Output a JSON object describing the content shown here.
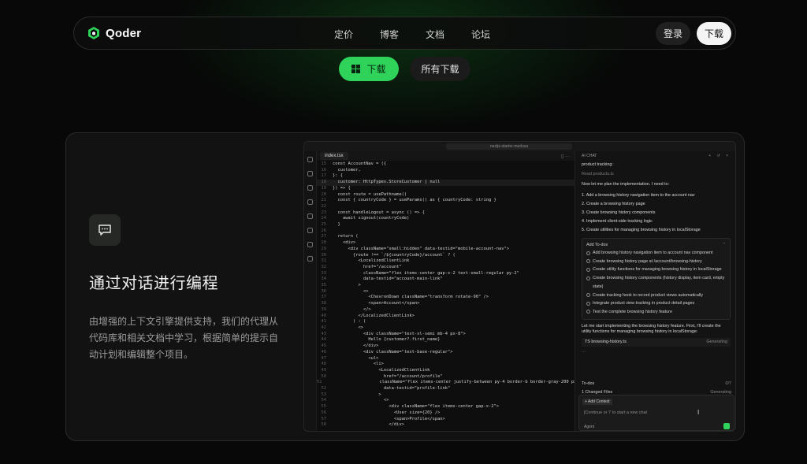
{
  "nav": {
    "brand": "Qoder",
    "links": [
      "定价",
      "博客",
      "文档",
      "论坛"
    ],
    "login": "登录",
    "download": "下载"
  },
  "hero": {
    "download": "下载",
    "all_downloads": "所有下载"
  },
  "feature": {
    "title": "通过对话进行编程",
    "description": "由增强的上下文引擎提供支持，我们的代理从代码库和相关文档中学习，根据简单的提示自动计划和编辑整个项目。"
  },
  "ide": {
    "window_title": "nextjs-starter-medusa",
    "tab": "index.tsx",
    "code_lines": [
      {
        "n": "15",
        "t": "const AccountNav = ({"
      },
      {
        "n": "16",
        "t": "  customer,"
      },
      {
        "n": "17",
        "t": "}: {"
      },
      {
        "n": "18",
        "t": "  customer: HttpTypes.StoreCustomer | null"
      },
      {
        "n": "19",
        "t": "}) => {"
      },
      {
        "n": "20",
        "t": "  const route = usePathname()"
      },
      {
        "n": "21",
        "t": "  const { countryCode } = useParams() as { countryCode: string }"
      },
      {
        "n": "22",
        "t": ""
      },
      {
        "n": "23",
        "t": "  const handleLogout = async () => {"
      },
      {
        "n": "24",
        "t": "    await signout(countryCode)"
      },
      {
        "n": "25",
        "t": "  }"
      },
      {
        "n": "26",
        "t": ""
      },
      {
        "n": "27",
        "t": "  return ("
      },
      {
        "n": "28",
        "t": "    <div>"
      },
      {
        "n": "29",
        "t": "      <div className=\"small:hidden\" data-testid=\"mobile-account-nav\">"
      },
      {
        "n": "30",
        "t": "        {route !== `/${countryCode}/account` ? ("
      },
      {
        "n": "31",
        "t": "          <LocalizedClientLink"
      },
      {
        "n": "32",
        "t": "            href=\"/account\""
      },
      {
        "n": "33",
        "t": "            className=\"flex items-center gap-x-2 text-small-regular py-2\""
      },
      {
        "n": "34",
        "t": "            data-testid=\"account-main-link\""
      },
      {
        "n": "35",
        "t": "          >"
      },
      {
        "n": "36",
        "t": "            <>"
      },
      {
        "n": "37",
        "t": "              <ChevronDown className=\"transform rotate-90\" />"
      },
      {
        "n": "38",
        "t": "              <span>Account</span>"
      },
      {
        "n": "39",
        "t": "            </>"
      },
      {
        "n": "40",
        "t": "          </LocalizedClientLink>"
      },
      {
        "n": "41",
        "t": "        ) : ("
      },
      {
        "n": "42",
        "t": "          <>"
      },
      {
        "n": "43",
        "t": "            <div className=\"text-xl-semi mb-4 px-8\">"
      },
      {
        "n": "44",
        "t": "              Hello {customer?.first_name}"
      },
      {
        "n": "45",
        "t": "            </div>"
      },
      {
        "n": "46",
        "t": "            <div className=\"text-base-regular\">"
      },
      {
        "n": "47",
        "t": "              <ul>"
      },
      {
        "n": "48",
        "t": "                <li>"
      },
      {
        "n": "49",
        "t": "                  <LocalizedClientLink"
      },
      {
        "n": "50",
        "t": "                    href=\"/account/profile\""
      },
      {
        "n": "51",
        "t": "                    className=\"flex items-center justify-between py-4 border-b border-gray-200 px-8\""
      },
      {
        "n": "52",
        "t": "                    data-testid=\"profile-link\""
      },
      {
        "n": "53",
        "t": "                  >"
      },
      {
        "n": "54",
        "t": "                    <>"
      },
      {
        "n": "55",
        "t": "                      <div className=\"flex items-center gap-x-2\">"
      },
      {
        "n": "56",
        "t": "                        <User size={20} />"
      },
      {
        "n": "57",
        "t": "                        <span>Profile</span>"
      },
      {
        "n": "58",
        "t": "                      </div>"
      }
    ],
    "chat": {
      "header": "AI CHAT",
      "intro": "product tracking:",
      "read_file": "Read products.ts",
      "plan_intro": "Now let me plan the implementation. I need to:",
      "steps": [
        "1. Add a browsing history navigation item to the account nav",
        "2. Create a browsing history page",
        "3. Create browsing history components",
        "4. Implement client-side tracking logic",
        "5. Create utilities for managing browsing history in localStorage"
      ],
      "todo_title": "Add To-dos",
      "todos": [
        "Add browsing history navigation item to account nav component",
        "Create browsing history page at /account/browsing-history",
        "Create utility functions for managing browsing history in localStorage",
        "Create browsing history components (history display, item card, empty state)",
        "Create tracking hook to record product views automatically",
        "Integrate product view tracking in product detail pages",
        "Test the complete browsing history feature"
      ],
      "start_msg": "Let me start implementing the browsing history feature. First, I'll create the utility functions for managing browsing history in localStorage:",
      "file_name": "TS browsing-history.ts",
      "file_status": "Generating",
      "ellipsis": "···",
      "todos_label": "To-dos",
      "todos_count": "0/7",
      "changed_files": "1 Changed Files",
      "changed_status": "Generating",
      "add_context": "+ Add Context",
      "placeholder": "[Continue or '/' to start a new chat",
      "agent": "Agent"
    }
  }
}
